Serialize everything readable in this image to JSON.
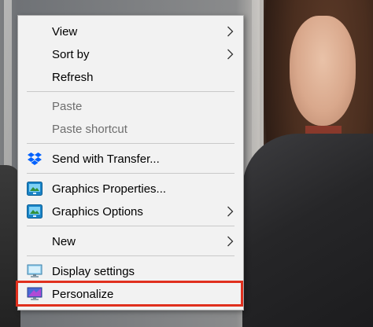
{
  "menu": {
    "items": [
      {
        "label": "View",
        "has_submenu": true,
        "disabled": false
      },
      {
        "label": "Sort by",
        "has_submenu": true,
        "disabled": false
      },
      {
        "label": "Refresh",
        "has_submenu": false,
        "disabled": false
      },
      {
        "label": "Paste",
        "has_submenu": false,
        "disabled": true
      },
      {
        "label": "Paste shortcut",
        "has_submenu": false,
        "disabled": true
      },
      {
        "label": "Send with Transfer...",
        "has_submenu": false,
        "disabled": false,
        "icon": "dropbox-icon"
      },
      {
        "label": "Graphics Properties...",
        "has_submenu": false,
        "disabled": false,
        "icon": "intel-graphics-icon"
      },
      {
        "label": "Graphics Options",
        "has_submenu": true,
        "disabled": false,
        "icon": "intel-graphics-icon"
      },
      {
        "label": "New",
        "has_submenu": true,
        "disabled": false
      },
      {
        "label": "Display settings",
        "has_submenu": false,
        "disabled": false,
        "icon": "monitor-icon"
      },
      {
        "label": "Personalize",
        "has_submenu": false,
        "disabled": false,
        "icon": "personalize-icon",
        "highlighted": true
      }
    ]
  },
  "colors": {
    "highlight_border": "#e0301e",
    "menu_background": "#f2f2f2",
    "disabled_text": "#6e6e6e",
    "dropbox_blue": "#0061fe"
  }
}
